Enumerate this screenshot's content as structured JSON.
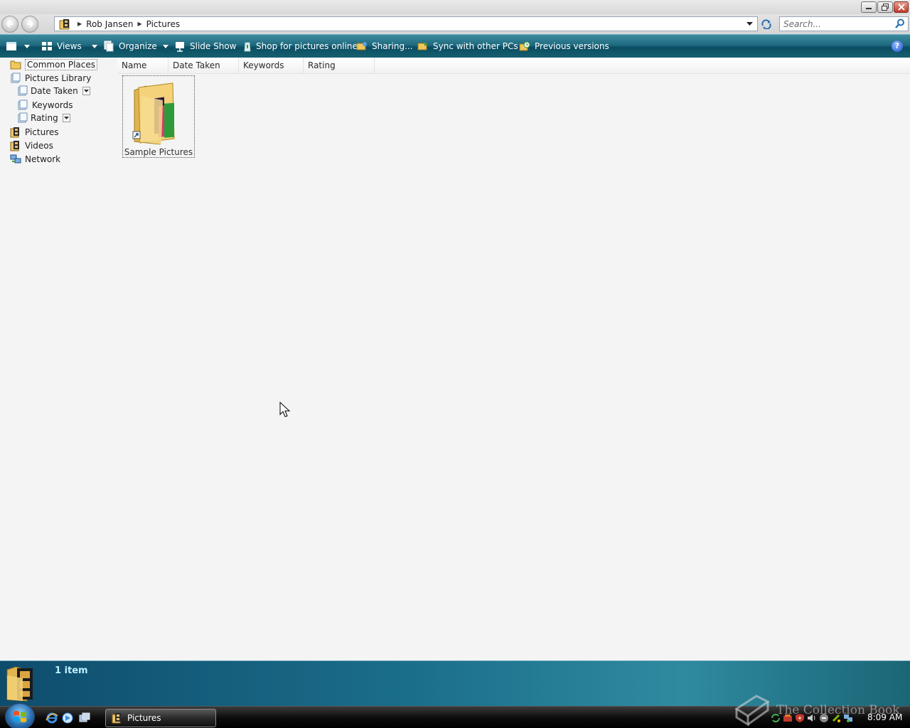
{
  "window": {
    "minimize_label": "Minimize",
    "maximize_label": "Maximize",
    "close_label": "Close"
  },
  "address": {
    "crumbs": [
      "Rob Jansen",
      "Pictures"
    ]
  },
  "search": {
    "placeholder": "Search..."
  },
  "commands": {
    "views": "Views",
    "organize": "Organize",
    "slideshow": "Slide Show",
    "shop": "Shop for pictures online",
    "sharing": "Sharing...",
    "sync": "Sync with other PCs",
    "previous": "Previous versions",
    "help": "?"
  },
  "tree": {
    "common_places": "Common Places",
    "pictures_library": "Pictures Library",
    "date_taken": "Date Taken",
    "keywords": "Keywords",
    "rating": "Rating",
    "pictures": "Pictures",
    "videos": "Videos",
    "network": "Network"
  },
  "columns": [
    "Name",
    "Date Taken",
    "Keywords",
    "Rating"
  ],
  "items": [
    {
      "label": "Sample Pictures"
    }
  ],
  "details": {
    "count": "1 item"
  },
  "taskbar": {
    "window_button": "Pictures",
    "clock": "8:09 AM"
  },
  "watermark": {
    "text": "The Collection Book"
  },
  "colors": {
    "cmdbar": "#1f6a80",
    "details": "#1b6e8a",
    "accent_text": "#bdf0ff"
  }
}
